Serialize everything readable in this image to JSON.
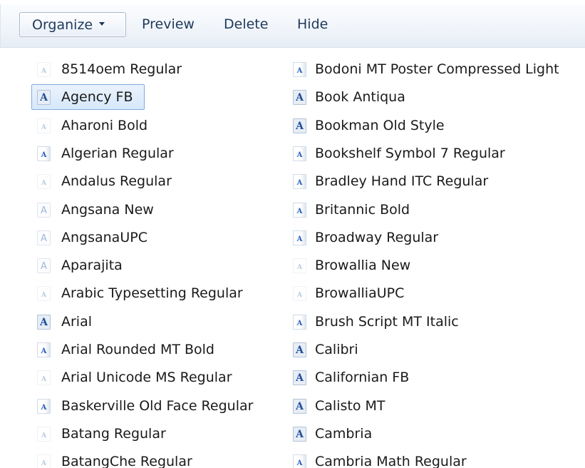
{
  "toolbar": {
    "organize_label": "Organize",
    "preview_label": "Preview",
    "delete_label": "Delete",
    "hide_label": "Hide"
  },
  "fonts": {
    "column1": [
      {
        "name": "8514oem Regular",
        "icon": "font-file-icon"
      },
      {
        "name": "Agency FB",
        "icon": "font-family-icon",
        "selected": true
      },
      {
        "name": "Aharoni Bold",
        "icon": "font-file-icon"
      },
      {
        "name": "Algerian Regular",
        "icon": "font-file-icon"
      },
      {
        "name": "Andalus Regular",
        "icon": "font-file-icon"
      },
      {
        "name": "Angsana New",
        "icon": "font-family-icon"
      },
      {
        "name": "AngsanaUPC",
        "icon": "font-family-icon"
      },
      {
        "name": "Aparajita",
        "icon": "font-family-icon"
      },
      {
        "name": "Arabic Typesetting Regular",
        "icon": "font-file-icon"
      },
      {
        "name": "Arial",
        "icon": "font-family-icon"
      },
      {
        "name": "Arial Rounded MT Bold",
        "icon": "font-file-icon"
      },
      {
        "name": "Arial Unicode MS Regular",
        "icon": "font-file-icon"
      },
      {
        "name": "Baskerville Old Face Regular",
        "icon": "font-file-icon"
      },
      {
        "name": "Batang Regular",
        "icon": "font-file-icon"
      },
      {
        "name": "BatangChe Regular",
        "icon": "font-file-icon"
      }
    ],
    "column2": [
      {
        "name": "Bodoni MT Poster Compressed Light",
        "icon": "font-file-icon"
      },
      {
        "name": "Book Antiqua",
        "icon": "font-family-icon"
      },
      {
        "name": "Bookman Old Style",
        "icon": "font-family-icon"
      },
      {
        "name": "Bookshelf Symbol 7 Regular",
        "icon": "font-file-icon"
      },
      {
        "name": "Bradley Hand ITC Regular",
        "icon": "font-file-icon"
      },
      {
        "name": "Britannic Bold",
        "icon": "font-file-icon"
      },
      {
        "name": "Broadway Regular",
        "icon": "font-file-icon"
      },
      {
        "name": "Browallia New",
        "icon": "font-file-icon"
      },
      {
        "name": "BrowalliaUPC",
        "icon": "font-file-icon"
      },
      {
        "name": "Brush Script MT Italic",
        "icon": "font-file-icon"
      },
      {
        "name": "Calibri",
        "icon": "font-family-icon"
      },
      {
        "name": "Californian FB",
        "icon": "font-family-icon"
      },
      {
        "name": "Calisto MT",
        "icon": "font-family-icon"
      },
      {
        "name": "Cambria",
        "icon": "font-family-icon"
      },
      {
        "name": "Cambria Math Regular",
        "icon": "font-file-icon"
      }
    ]
  },
  "icon_glyph": "A",
  "colors": {
    "toolbar_text": "#1e395b",
    "selection_border": "#84acdd",
    "selection_fill": "#d6e8fb",
    "icon_letter": "#1f4f9a"
  }
}
